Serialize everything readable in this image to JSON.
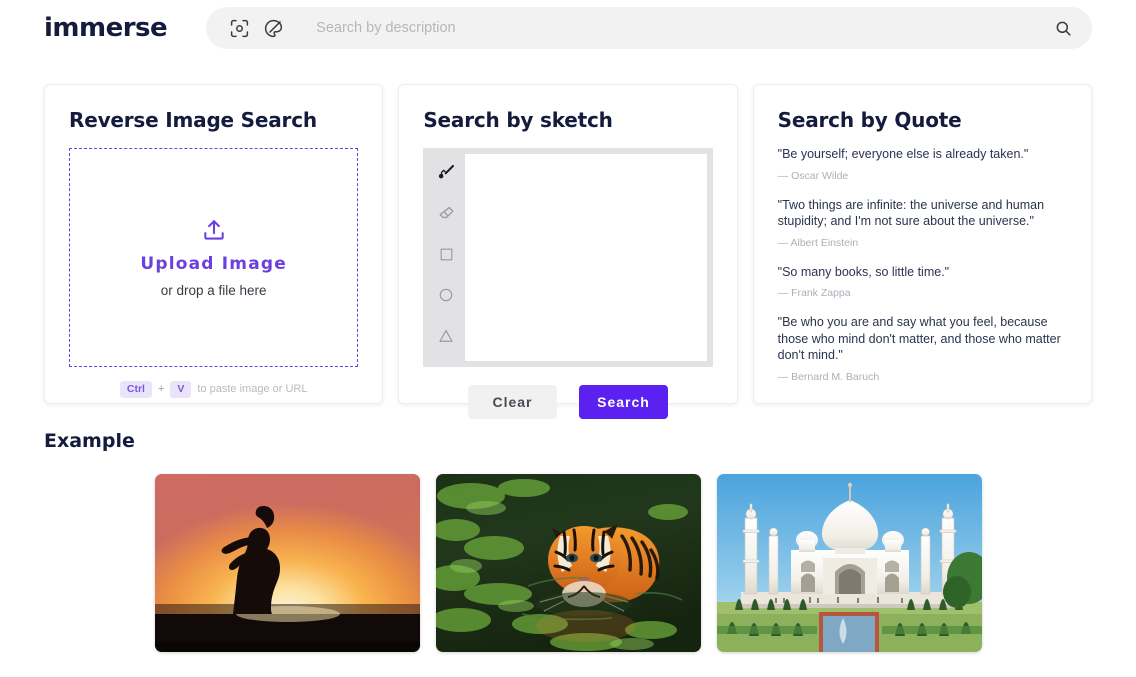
{
  "header": {
    "logo": "immerse",
    "icons": {
      "scan": "image-scan-icon",
      "palette": "color-palette-icon",
      "search": "search-icon"
    },
    "search": {
      "placeholder": "Search by description",
      "value": ""
    }
  },
  "cards": {
    "reverse_image": {
      "title": "Reverse Image Search",
      "upload_label": "Upload Image",
      "drop_hint": "or drop a file here",
      "upload_icon": "upload-icon",
      "paste": {
        "key1": "Ctrl",
        "separator": "+",
        "key2": "V",
        "text": "to paste image or URL"
      }
    },
    "sketch": {
      "title": "Search by sketch",
      "tools": [
        {
          "name": "brush-tool",
          "icon": "brush-icon",
          "selected": true
        },
        {
          "name": "eraser-tool",
          "icon": "eraser-icon",
          "selected": false
        },
        {
          "name": "square-tool",
          "icon": "square-icon",
          "selected": false
        },
        {
          "name": "circle-tool",
          "icon": "circle-icon",
          "selected": false
        },
        {
          "name": "triangle-tool",
          "icon": "triangle-icon",
          "selected": false
        }
      ],
      "clear_label": "Clear",
      "search_label": "Search"
    },
    "quote": {
      "title": "Search by Quote",
      "quotes": [
        {
          "text": "\"Be yourself; everyone else is already taken.\"",
          "author": "— Oscar Wilde"
        },
        {
          "text": "\"Two things are infinite: the universe and human stupidity; and I'm not sure about the universe.\"",
          "author": "— Albert Einstein"
        },
        {
          "text": "\"So many books, so little time.\"",
          "author": "— Frank Zappa"
        },
        {
          "text": "\"Be who you are and say what you feel, because those who mind don't matter, and those who matter don't mind.\"",
          "author": "— Bernard M. Baruch"
        }
      ]
    }
  },
  "example": {
    "title": "Example",
    "thumbs": [
      {
        "name": "example-thumb-sunset-silhouette",
        "alt": "Silhouette of a woman standing on a beach at sunset"
      },
      {
        "name": "example-thumb-tiger-swimming",
        "alt": "Tiger swimming in green algae covered water"
      },
      {
        "name": "example-thumb-taj-mahal",
        "alt": "Taj Mahal with reflecting pool and gardens"
      }
    ]
  },
  "colors": {
    "brand_navy": "#141b3d",
    "accent_purple": "#5b21f0",
    "upload_purple": "#6c3fe0",
    "kbd_bg": "#eae4fb",
    "searchbar_bg": "#f2f2f3",
    "canvas_frame": "#e2e2e4"
  }
}
